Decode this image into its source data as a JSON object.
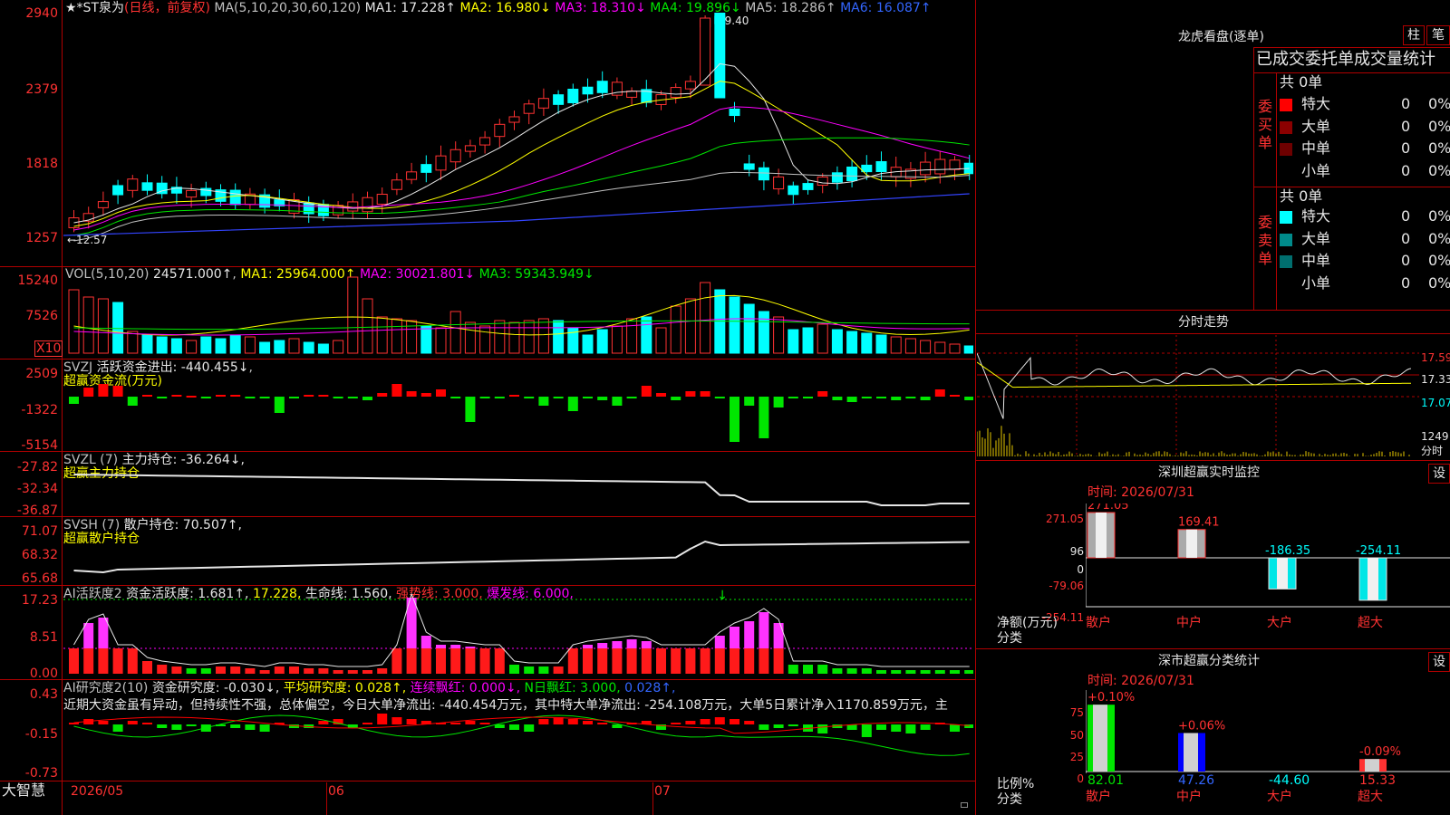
{
  "app": {
    "name": "大智慧"
  },
  "colors": {
    "up": "#ff3232",
    "down": "#00ffff",
    "frame": "#b00000",
    "buy_green": "#00e600"
  },
  "kline": {
    "title_stock": "★*ST泉为",
    "title_mode": "(日线，前复权)",
    "ma_param": "MA(5,10,20,30,60,120)",
    "ma1": "MA1: 17.228↑",
    "ma2": "MA2: 16.980↓",
    "ma3": "MA3: 18.310↓",
    "ma4": "MA4: 19.896↓",
    "ma5": "MA5: 18.286↑",
    "ma6": "MA6: 16.087↑",
    "yticks": [
      "2940",
      "2379",
      "1818",
      "1257"
    ],
    "high_mark": "29.40",
    "low_mark": "←12.57"
  },
  "vol": {
    "param": "VOL(5,10,20)",
    "value": "24571.000↑",
    "ma1": "MA1: 25964.000↑",
    "ma2": "MA2: 30021.801↓",
    "ma3": "MA3: 59343.949↓",
    "yticks": [
      "15240",
      "7526"
    ],
    "unit": "X10"
  },
  "svzj": {
    "name": "SVZJ",
    "label": "活跃资金进出: -440.455↓",
    "sub": "超赢资金流(万元)",
    "yticks": [
      "2509",
      "-1322",
      "-5154"
    ]
  },
  "svzl": {
    "name": "SVZL (7)",
    "label": "主力持仓: -36.264↓,",
    "sub": "超赢主力持仓",
    "yticks": [
      "-27.82",
      "-32.34",
      "-36.87"
    ]
  },
  "svsh": {
    "name": "SVSH (7)",
    "label": "散户持仓: 70.507↑,",
    "sub": "超赢散户持仓",
    "yticks": [
      "71.07",
      "68.32",
      "65.68"
    ]
  },
  "ai1": {
    "name": "AI活跃度2",
    "label": "资金活跃度: 1.681↑,",
    "v2": "17.228,",
    "life": "生命线: 1.560,",
    "strong": "强势线: 3.000,",
    "burst": "爆发线: 6.000,",
    "yticks": [
      "17.23",
      "8.51",
      "0.00"
    ]
  },
  "ai2": {
    "name": "AI研究度2(10)",
    "label": "资金研究度: -0.030↓,",
    "avg": "平均研究度: 0.028↑,",
    "red": "连续飘红: 0.000↓,",
    "nred": "N日飘红: 3.000,",
    "v5": "0.028↑,",
    "comment": "近期大资金虽有异动，但持续性不强，总体偏空，今日大单净流出: -440.454万元，其中特大单净流出: -254.108万元，大单5日累计净入1170.859万元，主",
    "yticks": [
      "0.43",
      "-0.15",
      "-0.73"
    ]
  },
  "xaxis": {
    "labels": [
      "2026/05",
      "06",
      "07"
    ]
  },
  "right": {
    "dragon_title": "龙虎看盘(逐单)",
    "btn_bar": "柱",
    "btn_pen": "笔",
    "order_title": "已成交委托单成交量统计",
    "buy_side": "委买单",
    "sell_side": "委卖单",
    "buy_total": "共 0单",
    "sell_total": "共 0单",
    "buy_rows": [
      {
        "name": "特大",
        "count": "0",
        "pct": "0%",
        "color": "#ff0000"
      },
      {
        "name": "大单",
        "count": "0",
        "pct": "0%",
        "color": "#8b0000"
      },
      {
        "name": "中单",
        "count": "0",
        "pct": "0%",
        "color": "#6e0000"
      },
      {
        "name": "小单",
        "count": "0",
        "pct": "0%",
        "color": "#000000"
      }
    ],
    "sell_rows": [
      {
        "name": "特大",
        "count": "0",
        "pct": "0%",
        "color": "#00ffff"
      },
      {
        "name": "大单",
        "count": "0",
        "pct": "0%",
        "color": "#008b8b"
      },
      {
        "name": "中单",
        "count": "0",
        "pct": "0%",
        "color": "#006e6e"
      },
      {
        "name": "小单",
        "count": "0",
        "pct": "0%",
        "color": "#000000"
      }
    ],
    "intraday_title": "分时走势",
    "intraday_ticks": [
      "17.59",
      "17.33",
      "17.07"
    ],
    "intraday_vol": "1249",
    "intraday_vol_label": "分时",
    "monitor_title": "深圳超赢实时监控",
    "monitor_btn": "设",
    "monitor_time": "时间: 2026/07/31",
    "monitor_yticks": [
      "271.05",
      "96",
      "0",
      "-79.06",
      "-254.11"
    ],
    "monitor_unit": "净额(万元)",
    "monitor_cat": "分类",
    "monitor_bars": [
      {
        "cat": "散户",
        "value": 271.05,
        "label": "271.05"
      },
      {
        "cat": "中户",
        "value": 169.41,
        "label": "169.41"
      },
      {
        "cat": "大户",
        "value": -186.35,
        "label": "-186.35"
      },
      {
        "cat": "超大",
        "value": -254.11,
        "label": "-254.11"
      }
    ],
    "stat_title": "深市超赢分类统计",
    "stat_btn": "设",
    "stat_time": "时间: 2026/07/31",
    "stat_yticks": [
      "75",
      "50",
      "25",
      "0"
    ],
    "stat_unit": "比例%",
    "stat_cat": "分类",
    "stat_bars": [
      {
        "cat": "散户",
        "value": 82.01,
        "label": "82.01",
        "chg": "+0.10%"
      },
      {
        "cat": "中户",
        "value": 47.26,
        "label": "47.26",
        "chg": "+0.06%"
      },
      {
        "cat": "大户",
        "value": -44.6,
        "label": "-44.60",
        "chg": ""
      },
      {
        "cat": "超大",
        "value": 15.33,
        "label": "15.33",
        "chg": "-0.09%"
      }
    ]
  }
}
